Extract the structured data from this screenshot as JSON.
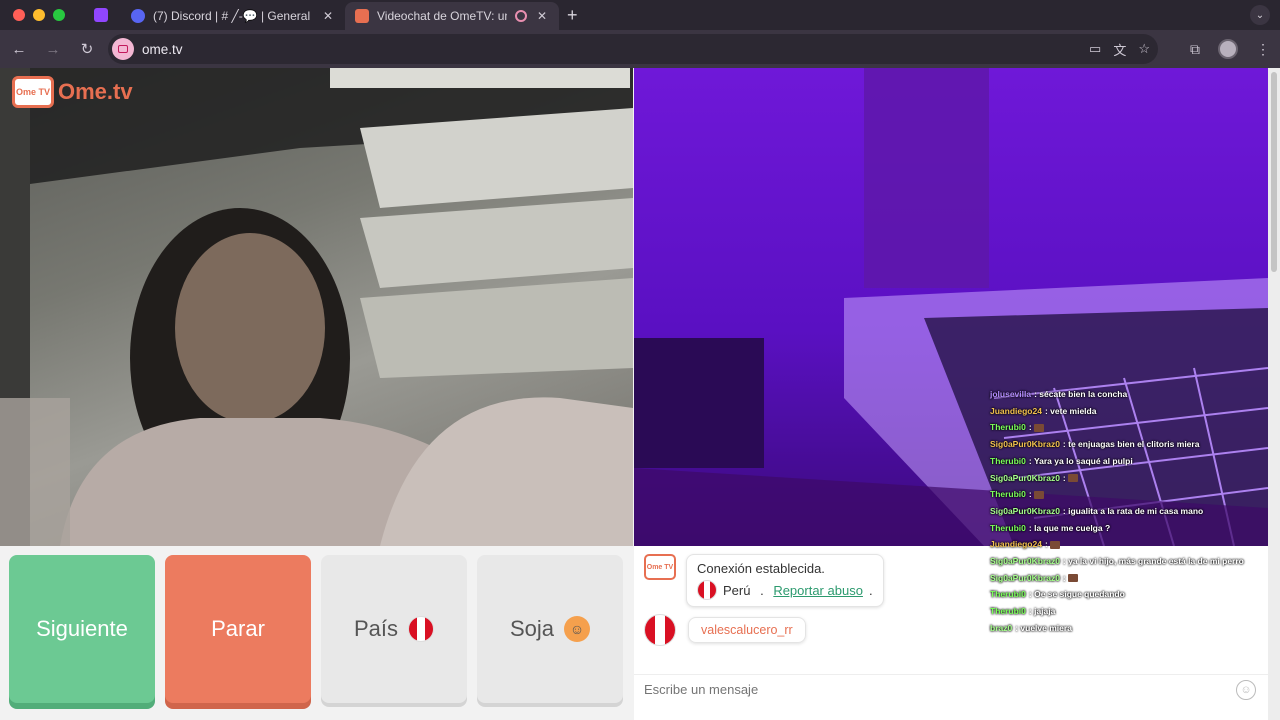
{
  "browser": {
    "tabs": [
      {
        "title": "(7) Discord | # ╱-💬 | General",
        "active": false
      },
      {
        "title": "Videochat de OmeTV: una",
        "active": true
      }
    ],
    "url": "ome.tv"
  },
  "logo": {
    "small": "Ome TV",
    "word": "Ome.tv"
  },
  "buttons": {
    "next": "Siguiente",
    "stop": "Parar",
    "country": "País",
    "gender": "Soja"
  },
  "chat": {
    "system_icon": "Ome TV",
    "connection": "Conexión establecida.",
    "country": "Perú",
    "separator": " . ",
    "report": "Reportar abuso",
    "period": ".",
    "username": "valescalucero_rr",
    "input_placeholder": "Escribe un mensaje"
  },
  "stream_chat": [
    {
      "user": "jolusevilla",
      "color": "#b38cff",
      "text": ": sécate bien la concha"
    },
    {
      "user": "Juandiego24",
      "color": "#f2c14e",
      "text": ": vete mielda"
    },
    {
      "user": "Therubi0",
      "color": "#7bff5a",
      "text": ": "
    },
    {
      "user": "Sig0aPur0Kbraz0",
      "color": "#f2c14e",
      "text": ": te enjuagas bien el clitoris miera"
    },
    {
      "user": "Therubi0",
      "color": "#7bff5a",
      "text": ": Yara ya lo saqué al pulpi"
    },
    {
      "user": "Sig0aPur0Kbraz0",
      "color": "#a6ff8c",
      "text": ": "
    },
    {
      "user": "Therubi0",
      "color": "#7bff5a",
      "text": ": "
    },
    {
      "user": "Sig0aPur0Kbraz0",
      "color": "#a6ff8c",
      "text": ": igualita a la rata de mi casa mano"
    },
    {
      "user": "Therubi0",
      "color": "#7bff5a",
      "text": ": la que me cuelga ?"
    },
    {
      "user": "Juandiego24",
      "color": "#f2c14e",
      "text": ": "
    },
    {
      "user": "Sig0aPur0Kbraz0",
      "color": "#a6ff8c",
      "text": ": ya la vi hijo, más grande está la de mi perro"
    },
    {
      "user": "Sig0aPur0Kbraz0",
      "color": "#a6ff8c",
      "text": ": "
    },
    {
      "user": "Therubi0",
      "color": "#7bff5a",
      "text": ": Oe se sigue quedando"
    },
    {
      "user": "Therubi0",
      "color": "#7bff5a",
      "text": ": jajaja"
    },
    {
      "user": "braz0",
      "color": "#a6ff8c",
      "text": ": vuelve miera"
    }
  ]
}
